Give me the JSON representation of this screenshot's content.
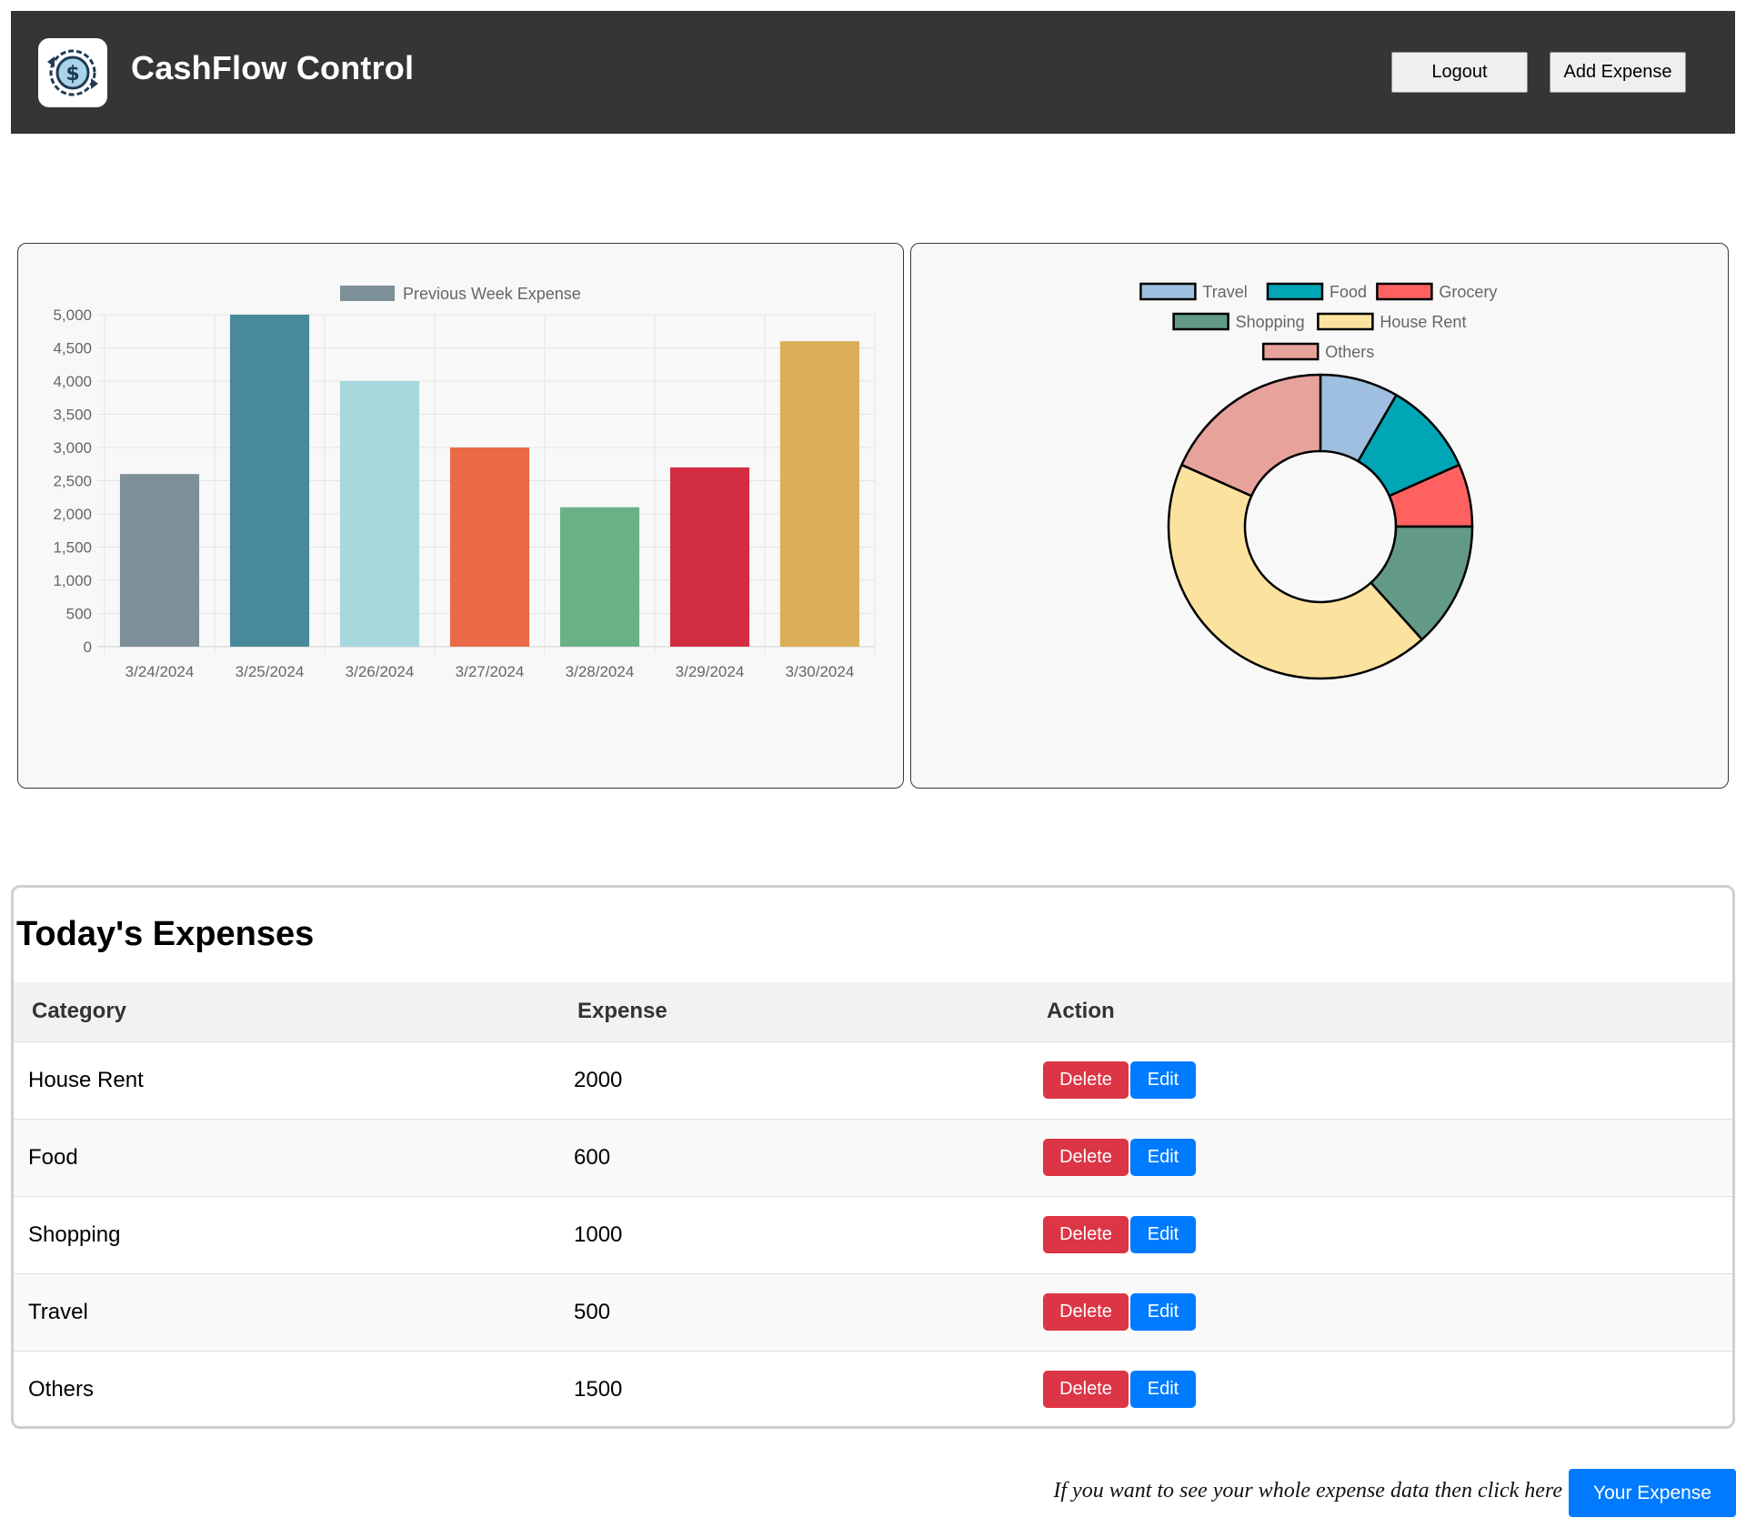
{
  "header": {
    "brand": "CashFlow Control",
    "logout_label": "Logout",
    "add_expense_label": "Add Expense",
    "logo_icon": "dollar-cycle-icon"
  },
  "bar_chart": {
    "type": "bar",
    "legend": "Previous Week Expense",
    "categories": [
      "3/24/2024",
      "3/25/2024",
      "3/26/2024",
      "3/27/2024",
      "3/28/2024",
      "3/29/2024",
      "3/30/2024"
    ],
    "values": [
      2600,
      5000,
      4000,
      3000,
      2100,
      2700,
      4600
    ],
    "colors": [
      "#7d8f99",
      "#488a99",
      "#a6d8de",
      "#ea6a47",
      "#6ab187",
      "#d32d41",
      "#dbae58"
    ],
    "ylim": [
      0,
      5000
    ],
    "yticks": [
      "0",
      "500",
      "1,000",
      "1,500",
      "2,000",
      "2,500",
      "3,000",
      "3,500",
      "4,000",
      "4,500",
      "5,000"
    ],
    "grid": true
  },
  "chart_data": {
    "type": "pie",
    "categories": [
      "Travel",
      "Food",
      "Grocery",
      "Shopping",
      "House Rent",
      "Others"
    ],
    "values": [
      500,
      600,
      400,
      800,
      2600,
      1100
    ],
    "colors": [
      "#9fbfe0",
      "#00a6b5",
      "#ff6161",
      "#629a87",
      "#fbe29f",
      "#e8a29c"
    ],
    "donut": true,
    "legend_position": "top"
  },
  "today": {
    "title": "Today's Expenses",
    "columns": [
      "Category",
      "Expense",
      "Action"
    ],
    "delete_label": "Delete",
    "edit_label": "Edit",
    "rows": [
      {
        "category": "House Rent",
        "expense": "2000"
      },
      {
        "category": "Food",
        "expense": "600"
      },
      {
        "category": "Shopping",
        "expense": "1000"
      },
      {
        "category": "Travel",
        "expense": "500"
      },
      {
        "category": "Others",
        "expense": "1500"
      }
    ]
  },
  "footer": {
    "note": "If you want to see your whole expense data then click here",
    "button_label": "Your Expense"
  },
  "colors": {
    "header_bg": "#353535",
    "delete": "#dc3545",
    "edit": "#007bff"
  }
}
